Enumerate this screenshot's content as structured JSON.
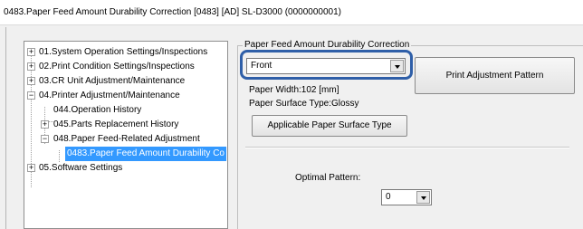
{
  "window": {
    "title": "0483.Paper Feed Amount Durability Correction  [0483]  [AD]  SL-D3000  (0000000001)"
  },
  "tree": {
    "items": [
      {
        "label": "01.System Operation Settings/Inspections",
        "expander": "+"
      },
      {
        "label": "02.Print Condition Settings/Inspections",
        "expander": "+"
      },
      {
        "label": "03.CR Unit Adjustment/Maintenance",
        "expander": "+"
      },
      {
        "label": "04.Printer Adjustment/Maintenance",
        "expander": "−"
      },
      {
        "label": "044.Operation History",
        "expander": ""
      },
      {
        "label": "045.Parts Replacement History",
        "expander": "+"
      },
      {
        "label": "048.Paper Feed-Related Adjustment",
        "expander": "−"
      },
      {
        "label": "0483.Paper Feed Amount Durability Co",
        "expander": "",
        "selected": true
      },
      {
        "label": "05.Software Settings",
        "expander": "+"
      }
    ]
  },
  "panel": {
    "group_title": "Paper Feed Amount Durability Correction",
    "side_select": {
      "value": "Front"
    },
    "paper_width": "Paper Width:102 [mm]",
    "paper_surface": "Paper Surface Type:Glossy",
    "applicable_button": "Applicable Paper Surface Type",
    "print_button": "Print Adjustment Pattern",
    "optimal_label": "Optimal Pattern:",
    "optimal_select": {
      "value": "0"
    }
  }
}
